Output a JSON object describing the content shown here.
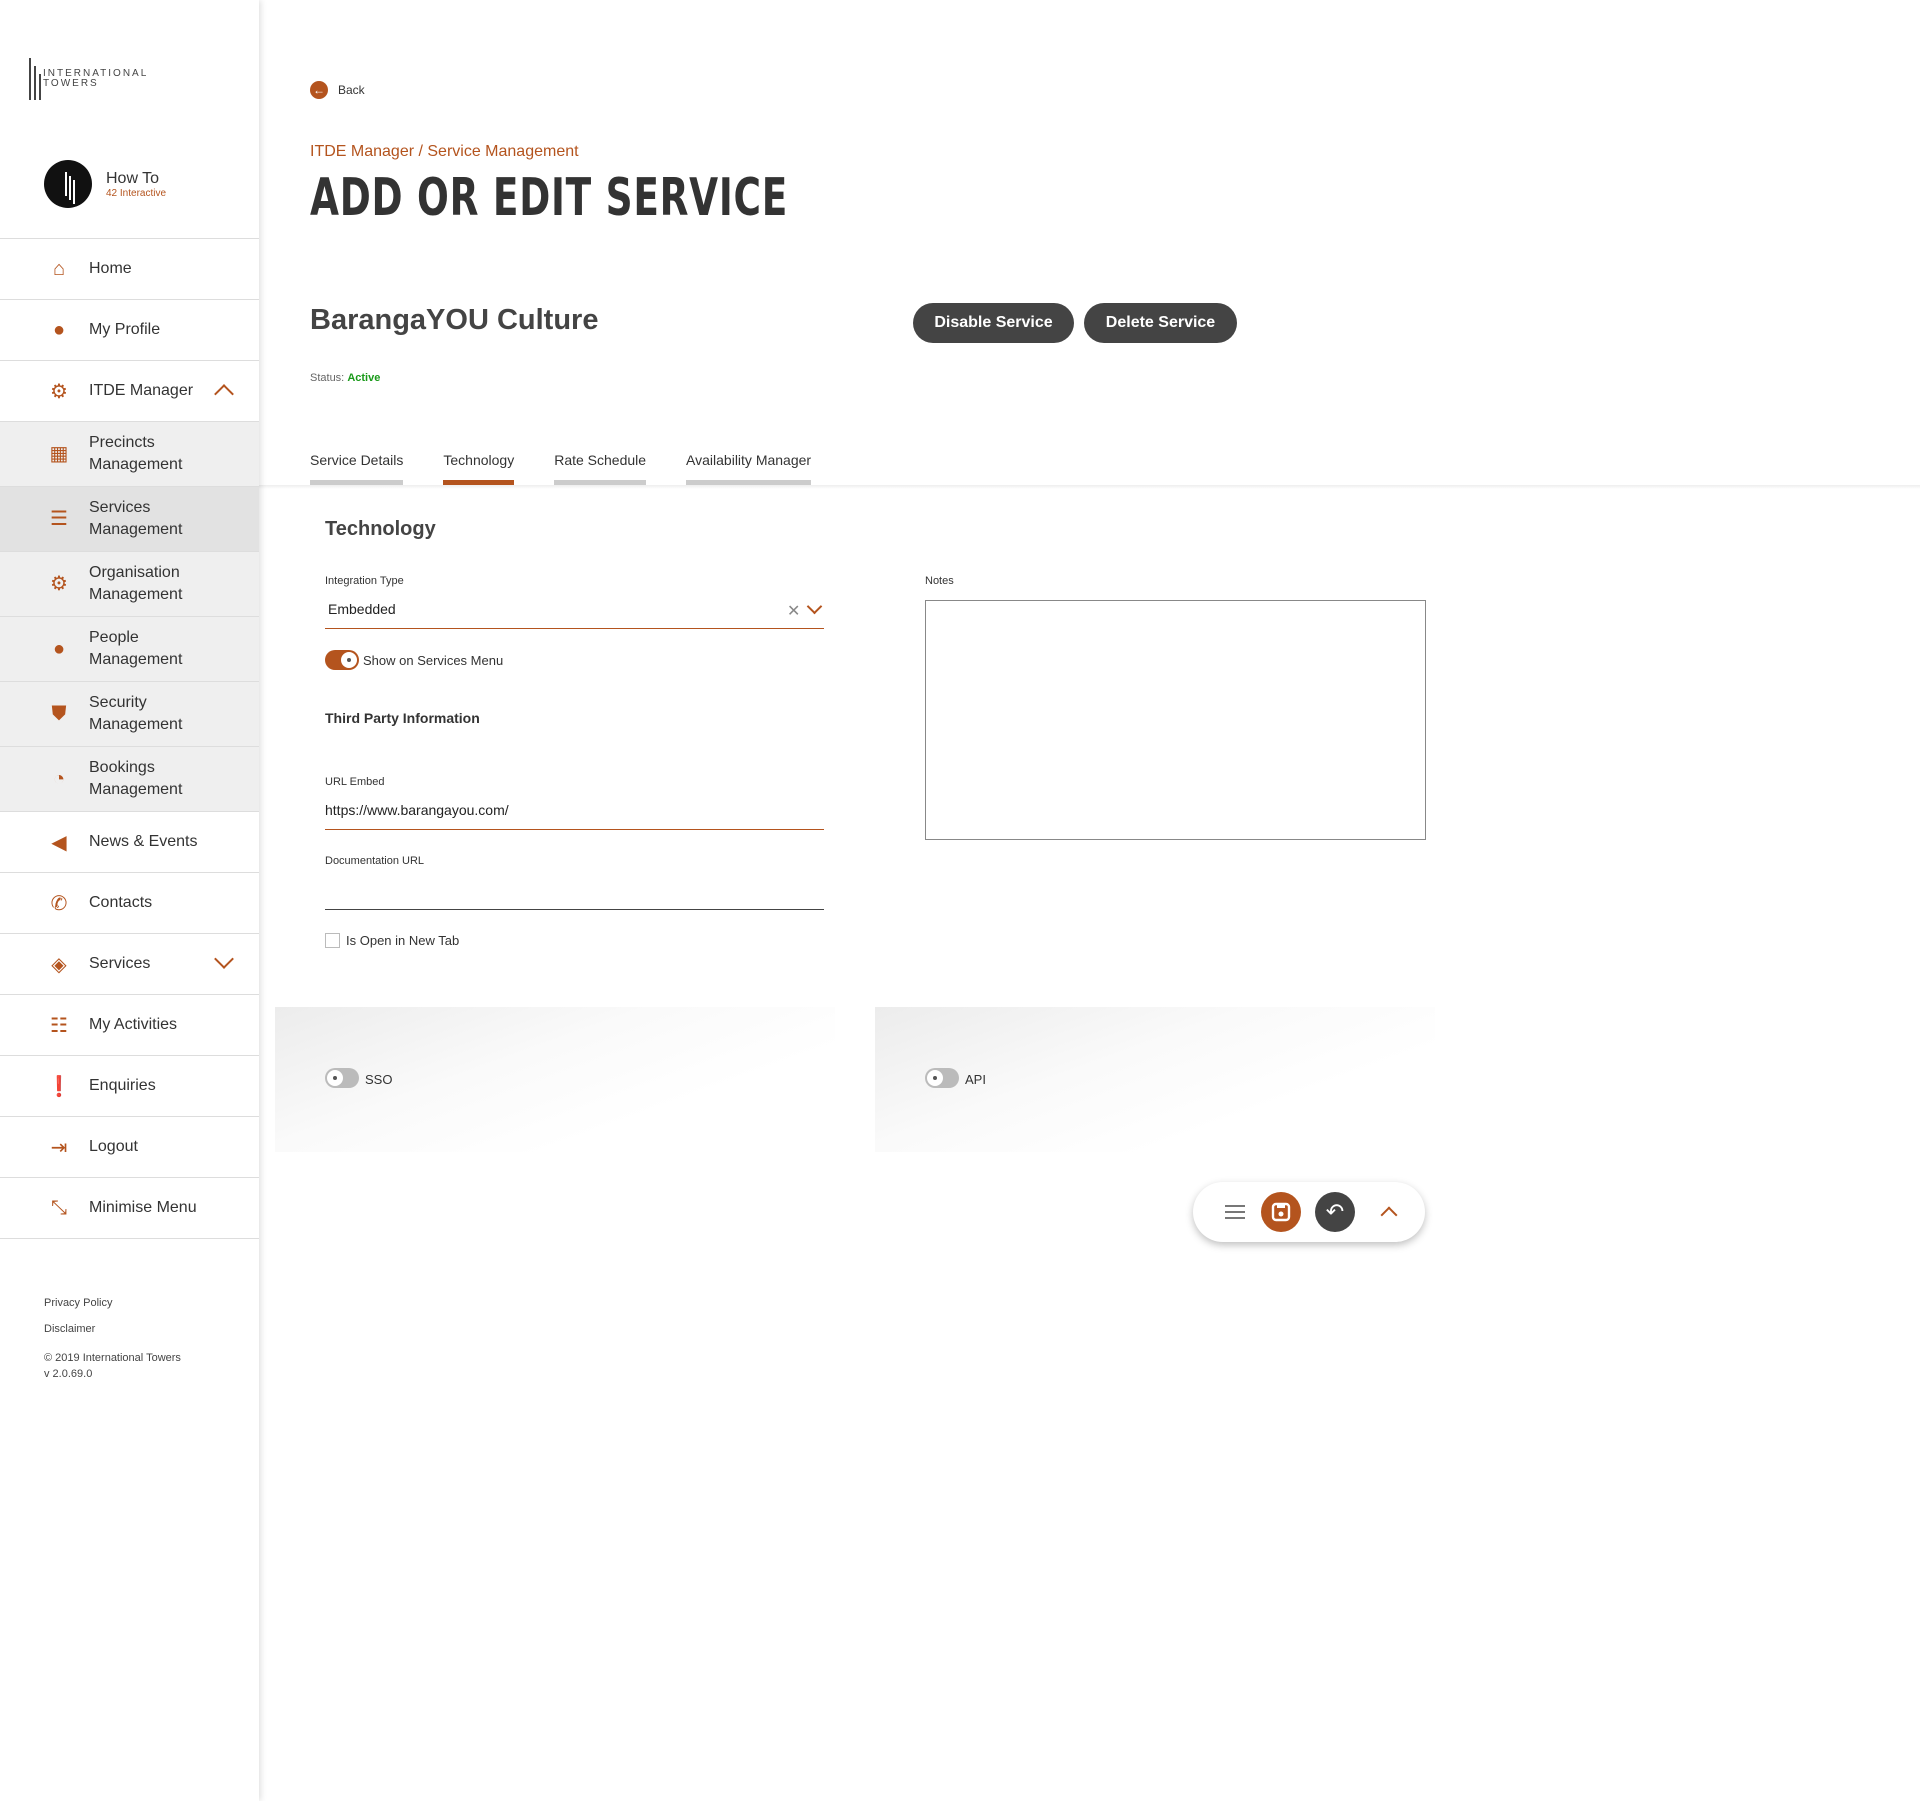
{
  "sidebar": {
    "logo_text": "INTERNATIONAL TOWERS",
    "user": {
      "name": "How To",
      "org": "42 Interactive"
    },
    "items": [
      {
        "label": "Home",
        "icon": "home-icon"
      },
      {
        "label": "My Profile",
        "icon": "user-icon"
      },
      {
        "label": "ITDE Manager",
        "icon": "cogs-icon"
      },
      {
        "label": "Precincts Management",
        "icon": "building-cog-icon"
      },
      {
        "label": "Services Management",
        "icon": "list-cog-icon"
      },
      {
        "label": "Organisation Management",
        "icon": "org-cog-icon"
      },
      {
        "label": "People Management",
        "icon": "people-cog-icon"
      },
      {
        "label": "Security Management",
        "icon": "shield-cog-icon"
      },
      {
        "label": "Bookings Management",
        "icon": "calendar-cog-icon"
      },
      {
        "label": "News & Events",
        "icon": "megaphone-icon"
      },
      {
        "label": "Contacts",
        "icon": "phone-icon"
      },
      {
        "label": "Services",
        "icon": "box-icon"
      },
      {
        "label": "My Activities",
        "icon": "list-icon"
      },
      {
        "label": "Enquiries",
        "icon": "alert-icon"
      },
      {
        "label": "Logout",
        "icon": "logout-icon"
      },
      {
        "label": "Minimise Menu",
        "icon": "minimise-icon"
      }
    ],
    "footer": {
      "privacy": "Privacy Policy",
      "disclaimer": "Disclaimer",
      "copyright": "© 2019 International Towers",
      "version": "v 2.0.69.0"
    }
  },
  "header": {
    "back_label": "Back",
    "breadcrumb": "ITDE Manager / Service Management",
    "title": "ADD OR EDIT SERVICE"
  },
  "service": {
    "name": "BarangaYOU Culture",
    "disable_label": "Disable Service",
    "delete_label": "Delete Service",
    "status_label": "Status:",
    "status_value": "Active"
  },
  "tabs": [
    {
      "label": "Service Details",
      "active": false
    },
    {
      "label": "Technology",
      "active": true
    },
    {
      "label": "Rate Schedule",
      "active": false
    },
    {
      "label": "Availability Manager",
      "active": false
    }
  ],
  "technology": {
    "section_title": "Technology",
    "integration_type_label": "Integration Type",
    "integration_type_value": "Embedded",
    "show_on_menu_label": "Show on Services Menu",
    "show_on_menu": true,
    "third_party_title": "Third Party Information",
    "url_embed_label": "URL Embed",
    "url_embed_value": "https://www.barangayou.com/",
    "doc_url_label": "Documentation URL",
    "doc_url_value": "",
    "open_new_tab_label": "Is Open in New Tab",
    "open_new_tab": false,
    "notes_label": "Notes",
    "notes_value": "",
    "sso_label": "SSO",
    "sso": false,
    "api_label": "API",
    "api": false
  },
  "colors": {
    "accent": "#b4541e",
    "dark": "#444444",
    "active_status": "#1a9a1a"
  }
}
